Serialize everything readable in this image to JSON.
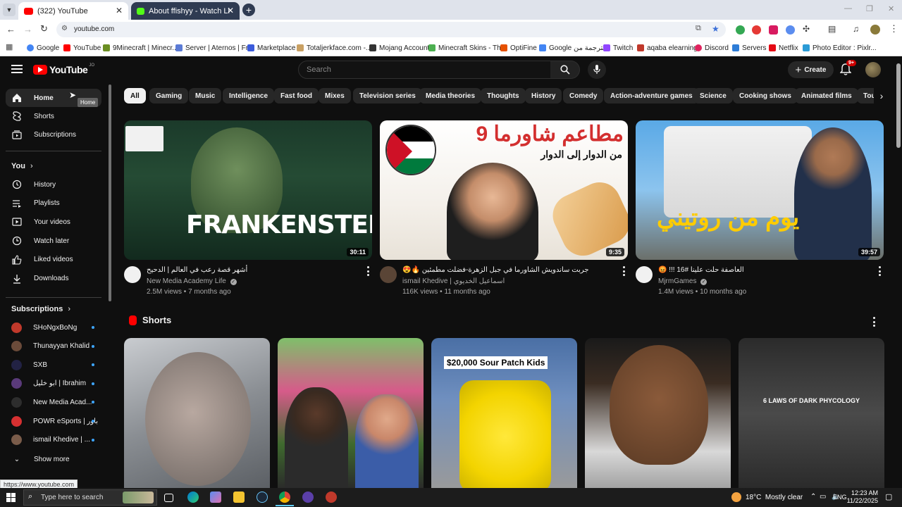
{
  "browser": {
    "tabs": [
      {
        "label": "(322) YouTube"
      },
      {
        "label": "About ffishyy - Watch Live on K"
      }
    ],
    "url": "youtube.com",
    "bookmarks": [
      {
        "label": "Google"
      },
      {
        "label": "YouTube"
      },
      {
        "label": "9Minecraft | Minecr..."
      },
      {
        "label": "Server | Aternos | Fr..."
      },
      {
        "label": "Marketplace"
      },
      {
        "label": "Totaljerkface.com -..."
      },
      {
        "label": "Mojang Account"
      },
      {
        "label": "Minecraft Skins - Th..."
      },
      {
        "label": "OptiFine"
      },
      {
        "label": "Google الترجمة من"
      },
      {
        "label": "Twitch"
      },
      {
        "label": "aqaba elearning"
      },
      {
        "label": "Discord"
      },
      {
        "label": "Servers"
      },
      {
        "label": "Netflix"
      },
      {
        "label": "Photo Editor : Pixlr..."
      }
    ],
    "status_url": "https://www.youtube.com"
  },
  "youtube": {
    "logo_text": "YouTube",
    "region": "JO",
    "search_placeholder": "Search",
    "create_label": "Create",
    "notif_count": "9+",
    "chips": [
      "All",
      "Gaming",
      "Music",
      "Intelligence",
      "Fast food",
      "Mixes",
      "Television series",
      "Media theories",
      "Thoughts",
      "History",
      "Comedy",
      "Action-adventure games",
      "Science",
      "Cooking shows",
      "Animated films",
      "Tou"
    ],
    "tooltip": "Home"
  },
  "sidebar": {
    "main": [
      {
        "label": "Home"
      },
      {
        "label": "Shorts"
      },
      {
        "label": "Subscriptions"
      }
    ],
    "you_heading": "You",
    "you": [
      {
        "label": "History"
      },
      {
        "label": "Playlists"
      },
      {
        "label": "Your videos"
      },
      {
        "label": "Watch later"
      },
      {
        "label": "Liked videos"
      },
      {
        "label": "Downloads"
      }
    ],
    "subs_heading": "Subscriptions",
    "subs": [
      {
        "label": "SHoNgxBoNg",
        "color": "#c0392b"
      },
      {
        "label": "Thunayyan Khalid",
        "color": "#6b4b3a"
      },
      {
        "label": "SXB",
        "color": "#222244"
      },
      {
        "label": "ابو خليل | Ibrahim",
        "color": "#5a3a7a"
      },
      {
        "label": "New Media Acad...",
        "color": "#2d2d2d"
      },
      {
        "label": "POWR eSports | باور",
        "color": "#d63031"
      },
      {
        "label": "ismail Khedive | ...",
        "color": "#7a5c4a"
      }
    ],
    "show_more": "Show more"
  },
  "videos": [
    {
      "thumb_text": "FRANKENSTEIN",
      "duration": "30:11",
      "title": "أشهر قصة رعب في العالم | الدحيح",
      "channel": "New Media Academy Life",
      "views": "2.5M views",
      "age": "7 months ago",
      "stats": "2.5M views • 7 months ago"
    },
    {
      "thumb_text": "9 مطاعم شاورما",
      "thumb_sub": "من الدوار إلى الدوار",
      "duration": "9:35",
      "title": "😍🔥 جربت ساندويش الشاورما في جبل الزهرة-فضلت مطمئين",
      "channel": "ismail Khedive | اسماعيل الخديوي",
      "views": "116K views",
      "age": "11 months ago",
      "stats": "116K views • 11 months ago"
    },
    {
      "thumb_text": "يوم من روتيني",
      "duration": "39:57",
      "title": "😡 !!! 16# العاصفة حلت علينا",
      "channel": "MjrmGames",
      "views": "1.4M views",
      "age": "10 months ago",
      "stats": "1.4M views • 10 months ago"
    }
  ],
  "shorts": {
    "heading": "Shorts",
    "items": [
      {
        "caption": ""
      },
      {
        "caption": ""
      },
      {
        "caption": "$20,000 Sour Patch Kids"
      },
      {
        "caption": ""
      },
      {
        "caption": "6 LAWS OF DARK PHYCOLOGY"
      }
    ]
  },
  "taskbar": {
    "search_placeholder": "Type here to search",
    "weather": "18°C  Mostly clear",
    "lang": "ENG",
    "time": "12:23 AM",
    "date": "11/22/2025"
  }
}
